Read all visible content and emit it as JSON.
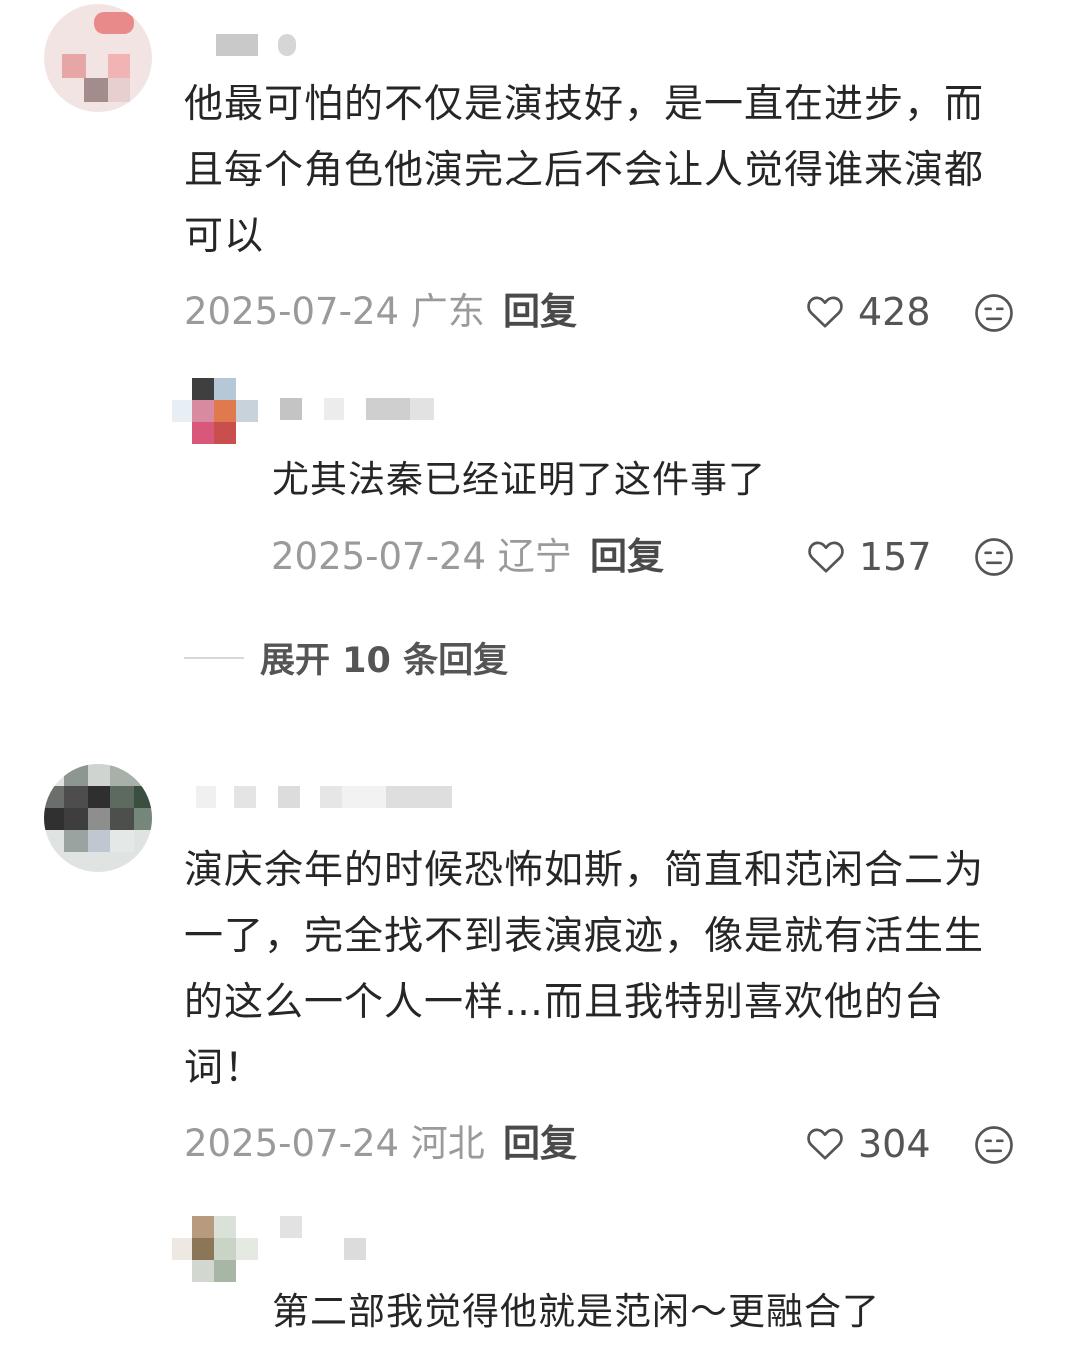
{
  "comments": [
    {
      "text_lines": [
        "他最可怕的不仅是演技好，是一直在进步，而",
        "且每个角色他演完之后不会让人觉得谁来演都",
        "可以"
      ],
      "date": "2025-07-24",
      "location": "广东",
      "reply_label": "回复",
      "likes": "428",
      "reply": {
        "text": "尤其法秦已经证明了这件事了",
        "date": "2025-07-24",
        "location": "辽宁",
        "reply_label": "回复",
        "likes": "157"
      },
      "expand_label": "展开 10 条回复"
    },
    {
      "text_lines": [
        "演庆余年的时候恐怖如斯，简直和范闲合二为",
        "一了，完全找不到表演痕迹，像是就有活生生",
        "的这么一个人一样…而且我特别喜欢他的台",
        "词！"
      ],
      "date": "2025-07-24",
      "location": "河北",
      "reply_label": "回复",
      "likes": "304",
      "reply": {
        "text": "第二部我觉得他就是范闲～更融合了"
      }
    }
  ],
  "icons": {
    "like": "heart-outline-icon",
    "dislike": "meh-face-icon"
  },
  "colors": {
    "text": "#262626",
    "meta": "#9a9a9a",
    "icon": "#555555"
  }
}
